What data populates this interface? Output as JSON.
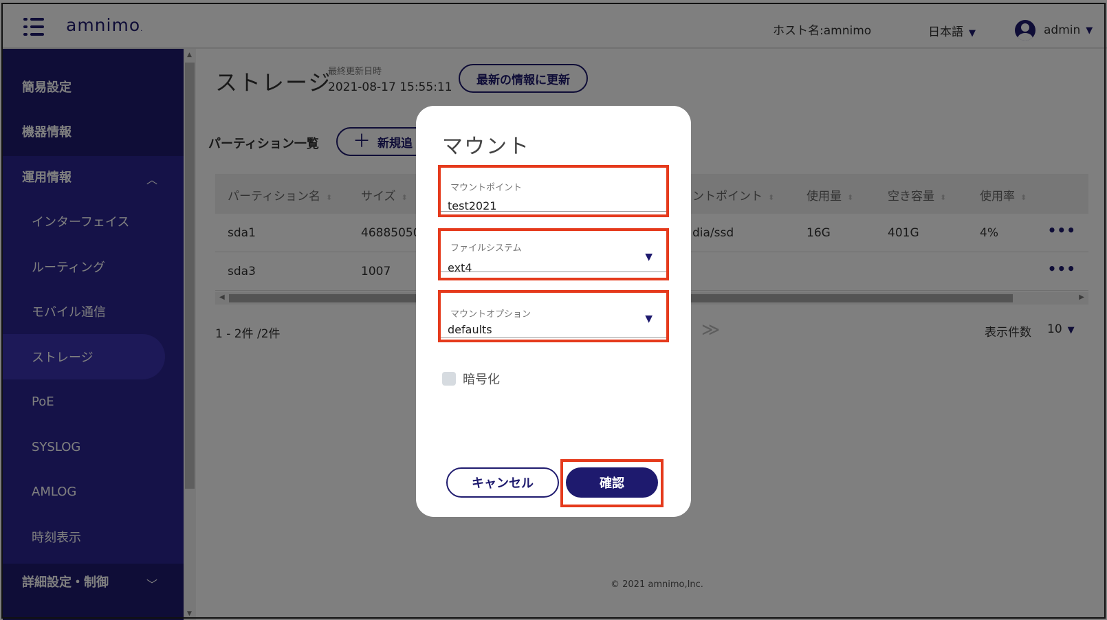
{
  "header": {
    "logo": "amnimo",
    "host_label": "ホスト名:amnimo",
    "language": "日本語",
    "user": "admin",
    "caret": "▼"
  },
  "sidebar": {
    "items": [
      {
        "label": "簡易設定"
      },
      {
        "label": "機器情報"
      },
      {
        "label": "運用情報",
        "chevron": "︿"
      },
      {
        "label": "インターフェイス"
      },
      {
        "label": "ルーティング"
      },
      {
        "label": "モバイル通信"
      },
      {
        "label": "ストレージ"
      },
      {
        "label": "PoE"
      },
      {
        "label": "SYSLOG"
      },
      {
        "label": "AMLOG"
      },
      {
        "label": "時刻表示"
      },
      {
        "label": "詳細設定・制御",
        "chevron": "﹀"
      }
    ]
  },
  "page": {
    "title": "ストレージ",
    "updated_label": "最終更新日時",
    "updated_time": "2021-08-17 15:55:11",
    "refresh_label": "最新の情報に更新",
    "section_title": "パーティション一覧",
    "add_label": "新規追",
    "add_icon": "＋"
  },
  "table": {
    "columns": [
      {
        "label": "パーティション名"
      },
      {
        "label": "サイズ"
      },
      {
        "label": "ントポイント"
      },
      {
        "label": "使用量"
      },
      {
        "label": "空き容量"
      },
      {
        "label": "使用率"
      }
    ],
    "rows": [
      {
        "name": "sda1",
        "size": "46885050",
        "mount": "dia/ssd",
        "used": "16G",
        "free": "401G",
        "usage": "4%",
        "actions": "•••"
      },
      {
        "name": "sda3",
        "size": "1007",
        "mount": "",
        "used": "",
        "free": "",
        "usage": "",
        "actions": "•••"
      }
    ],
    "sort_icon": "⬍"
  },
  "pager": {
    "range": "1 - 2件 /2件",
    "next": "≫",
    "per_page_label": "表示件数",
    "per_page_value": "10"
  },
  "footer": "© 2021 amnimo,Inc.",
  "dialog": {
    "title": "マウント",
    "mount_point_label": "マウントポイント",
    "mount_point_value": "test2021",
    "filesystem_label": "ファイルシステム",
    "filesystem_value": "ext4",
    "mount_option_label": "マウントオプション",
    "mount_option_value": "defaults",
    "encrypt_label": "暗号化",
    "cancel_label": "キャンセル",
    "confirm_label": "確認",
    "dropdown_icon": "▼"
  },
  "colors": {
    "brand": "#1e1a6e",
    "highlight": "#e53a1c"
  }
}
